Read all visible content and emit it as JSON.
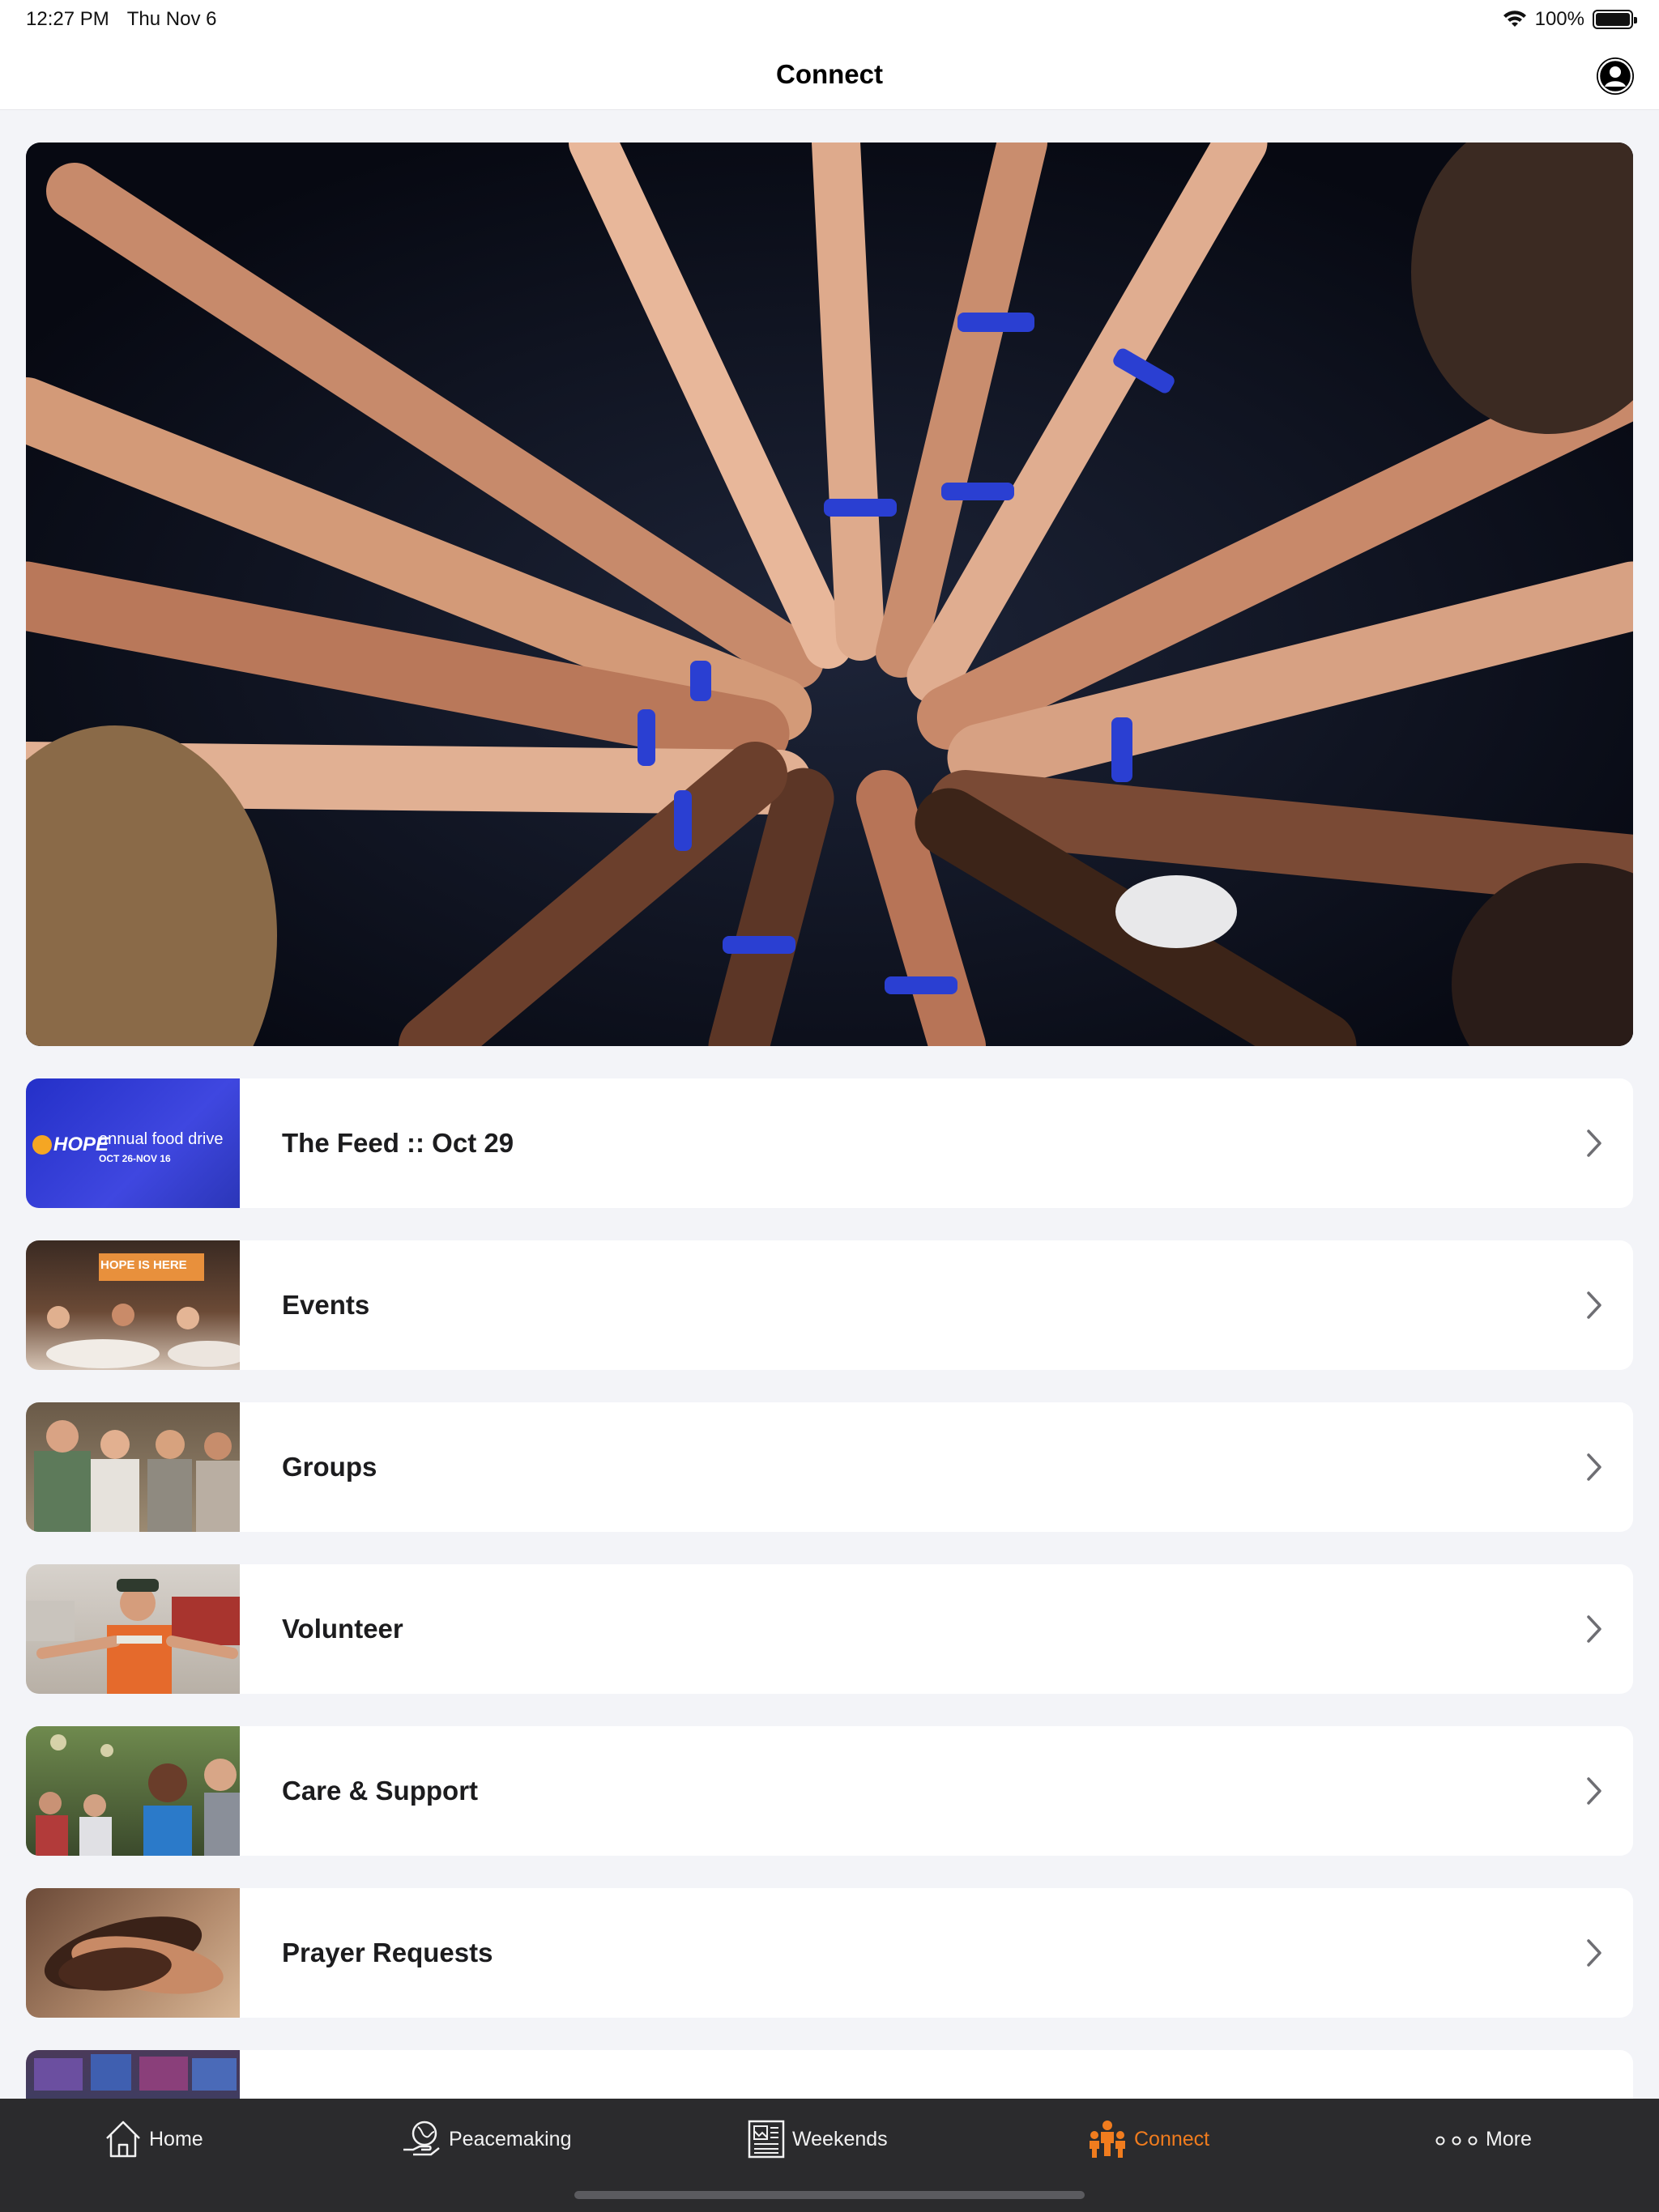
{
  "status_bar": {
    "time": "12:27 PM",
    "date": "Thu Nov 6",
    "battery": "100%"
  },
  "nav": {
    "title": "Connect"
  },
  "list": {
    "items": [
      {
        "label": "The Feed :: Oct 29",
        "thumb_text_1": "HOPE",
        "thumb_text_2": "annual food drive",
        "thumb_text_3": "OCT 26-NOV 16"
      },
      {
        "label": "Events",
        "thumb_text_1": "HOPE IS HERE"
      },
      {
        "label": "Groups"
      },
      {
        "label": "Volunteer"
      },
      {
        "label": "Care & Support"
      },
      {
        "label": "Prayer Requests"
      },
      {
        "label": ""
      }
    ]
  },
  "tabs": [
    {
      "label": "Home",
      "icon": "house-icon"
    },
    {
      "label": "Peacemaking",
      "icon": "globe-hand-icon"
    },
    {
      "label": "Weekends",
      "icon": "newspaper-icon"
    },
    {
      "label": "Connect",
      "icon": "people-icon",
      "active": true
    },
    {
      "label": "More",
      "icon": "ellipsis-icon"
    }
  ],
  "colors": {
    "accent": "#f07c1e",
    "tab_bar": "#2b2b2d",
    "background": "#f3f4f8"
  }
}
